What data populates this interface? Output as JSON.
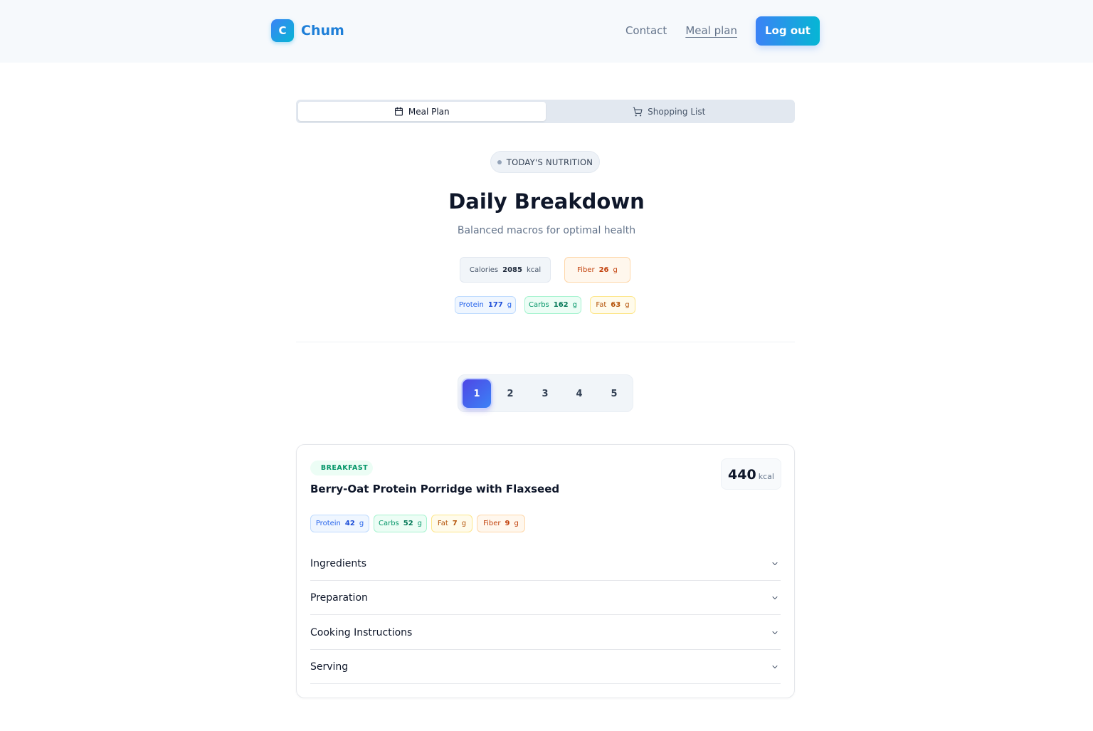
{
  "header": {
    "logo_letter": "C",
    "brand": "Chum",
    "nav": {
      "contact": "Contact",
      "meal_plan": "Meal plan"
    },
    "logout": "Log out"
  },
  "tabs": {
    "meal_plan": "Meal Plan",
    "shopping_list": "Shopping List",
    "active": "Meal Plan"
  },
  "hero": {
    "pill": "TODAY'S NUTRITION",
    "title": "Daily Breakdown",
    "subtitle": "Balanced macros for optimal health"
  },
  "daily_totals": {
    "calories": {
      "label": "Calories",
      "value": "2085",
      "unit": "kcal"
    },
    "fiber": {
      "label": "Fiber",
      "value": "26",
      "unit": "g"
    },
    "protein": {
      "label": "Protein",
      "value": "177",
      "unit": "g"
    },
    "carbs": {
      "label": "Carbs",
      "value": "162",
      "unit": "g"
    },
    "fat": {
      "label": "Fat",
      "value": "63",
      "unit": "g"
    }
  },
  "pager": {
    "pages": [
      "1",
      "2",
      "3",
      "4",
      "5"
    ],
    "current": "1"
  },
  "meal": {
    "tag": "BREAKFAST",
    "title": "Berry-Oat Protein Porridge with Flaxseed",
    "kcal_value": "440",
    "kcal_unit": "kcal",
    "macros": {
      "protein": {
        "label": "Protein",
        "value": "42",
        "unit": "g"
      },
      "carbs": {
        "label": "Carbs",
        "value": "52",
        "unit": "g"
      },
      "fat": {
        "label": "Fat",
        "value": "7",
        "unit": "g"
      },
      "fiber": {
        "label": "Fiber",
        "value": "9",
        "unit": "g"
      }
    },
    "sections": [
      "Ingredients",
      "Preparation",
      "Cooking Instructions",
      "Serving"
    ]
  },
  "icons": {
    "meal_plan_tab": "calendar-icon",
    "shopping_tab": "cart-icon",
    "section_toggle": "chevron-down-icon",
    "pill_dot": "dot-icon"
  },
  "colors": {
    "brand": "#1e7fd8",
    "primary_gradient_start": "#3b82f6",
    "primary_gradient_end": "#06b6d4",
    "pager_active": "#4f46e5"
  }
}
